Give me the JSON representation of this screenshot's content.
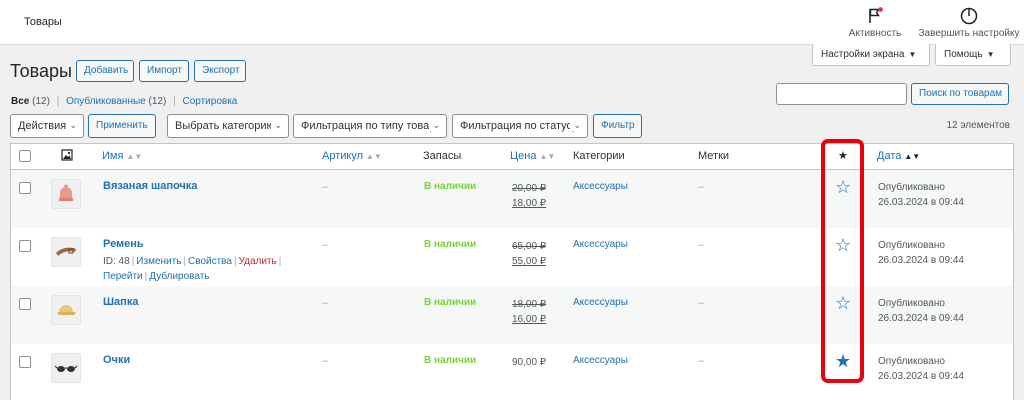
{
  "topbar": {
    "title": "Товары",
    "activity_label": "Активность",
    "finish_label": "Завершить настройку"
  },
  "screen_options": {
    "screen": "Настройки экрана",
    "help": "Помощь"
  },
  "page": {
    "title": "Товары",
    "buttons": {
      "add": "Добавить",
      "import": "Импорт",
      "export": "Экспорт"
    }
  },
  "filters": {
    "all": "Все",
    "all_count": "(12)",
    "published": "Опубликованные",
    "published_count": "(12)",
    "sort": "Сортировка",
    "sep": "|"
  },
  "search": {
    "button": "Поиск по товарам",
    "value": ""
  },
  "bulk": {
    "actions": "Действия",
    "apply": "Применить",
    "category": "Выбрать категорию",
    "type_filter": "Фильтрация по типу товар",
    "status_filter": "Фильтрация по статусу",
    "filter": "Фильтр",
    "count": "12 элементов"
  },
  "columns": {
    "name": "Имя",
    "sku": "Артикул",
    "stock": "Запасы",
    "price": "Цена",
    "categories": "Категории",
    "tags": "Метки",
    "featured": "★",
    "date": "Дата"
  },
  "rows": [
    {
      "name": "Вязаная шапочка",
      "sku": "–",
      "stock": "В наличии",
      "price_old": "20,00 ₽",
      "price_new": "18,00 ₽",
      "category": "Аксессуары",
      "tags": "–",
      "featured": false,
      "status": "Опубликовано",
      "date": "26.03.2024 в 09:44"
    },
    {
      "name": "Ремень",
      "sku": "–",
      "stock": "В наличии",
      "price_old": "65,00 ₽",
      "price_new": "55,00 ₽",
      "category": "Аксессуары",
      "tags": "–",
      "featured": false,
      "status": "Опубликовано",
      "date": "26.03.2024 в 09:44",
      "actions": {
        "id": "ID: 48",
        "edit": "Изменить",
        "props": "Свойства",
        "delete": "Удалить",
        "view": "Перейти",
        "duplicate": "Дублировать"
      }
    },
    {
      "name": "Шапка",
      "sku": "–",
      "stock": "В наличии",
      "price_old": "18,00 ₽",
      "price_new": "16,00 ₽",
      "category": "Аксессуары",
      "tags": "–",
      "featured": false,
      "status": "Опубликовано",
      "date": "26.03.2024 в 09:44"
    },
    {
      "name": "Очки",
      "sku": "–",
      "stock": "В наличии",
      "price": "90,00 ₽",
      "category": "Аксессуары",
      "tags": "–",
      "featured": true,
      "status": "Опубликовано",
      "date": "26.03.2024 в 09:44"
    }
  ],
  "icons": {
    "activity": "flag-icon",
    "finish": "progress-circle-icon",
    "image_column": "image-icon",
    "featured_on": "star-filled-icon",
    "featured_off": "star-outline-icon"
  },
  "colors": {
    "link": "#2271b1",
    "in_stock": "#7ad03a",
    "delete": "#b32d2e",
    "highlight": "#e8000b"
  }
}
